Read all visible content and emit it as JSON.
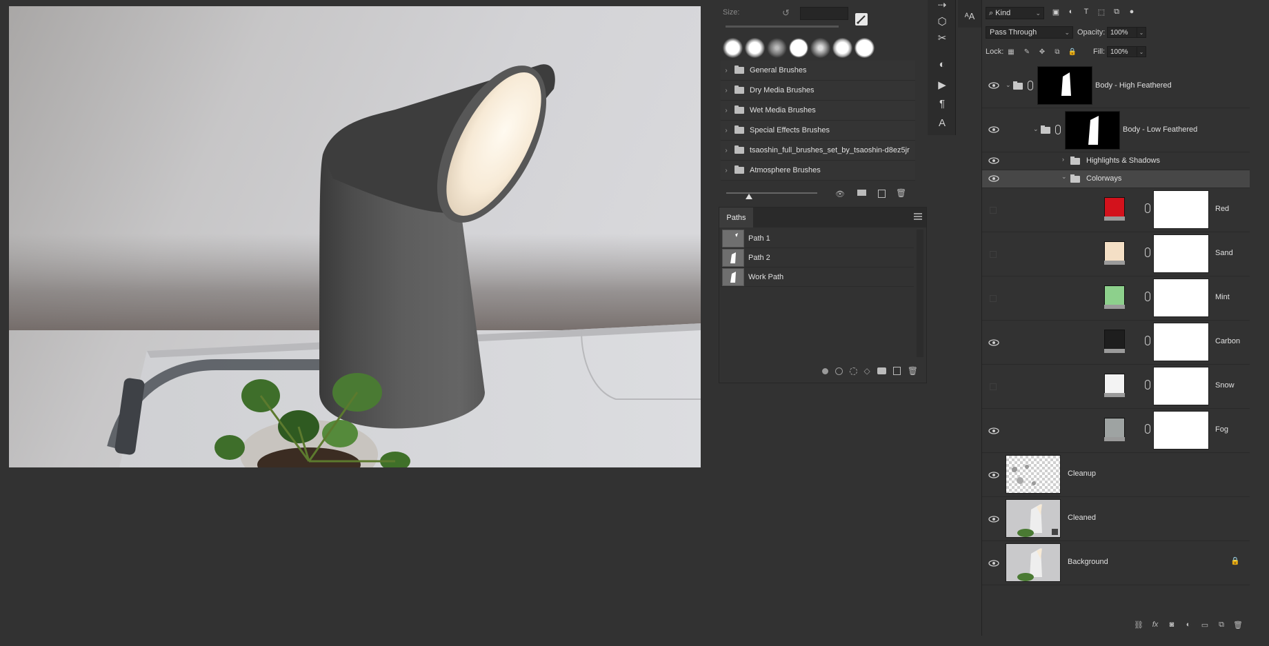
{
  "brushes": {
    "size_label": "Size:",
    "folders": [
      {
        "label": "General Brushes"
      },
      {
        "label": "Dry Media Brushes"
      },
      {
        "label": "Wet Media Brushes"
      },
      {
        "label": "Special Effects Brushes"
      },
      {
        "label": "tsaoshin_full_brushes_set_by_tsaoshin-d8ez5jr"
      },
      {
        "label": "Atmosphere Brushes"
      }
    ]
  },
  "paths": {
    "tab_label": "Paths",
    "items": [
      {
        "label": "Path 1"
      },
      {
        "label": "Path 2"
      },
      {
        "label": "Work Path"
      }
    ]
  },
  "tools": [
    "history-icon",
    "3d-icon",
    "tool-presets-icon",
    "adjustments-icon",
    "actions-icon",
    "paragraph-icon",
    "character-icon"
  ],
  "layers": {
    "filter_kind": "Kind",
    "blend_mode": "Pass Through",
    "opacity_label": "Opacity:",
    "opacity_value": "100%",
    "lock_label": "Lock:",
    "fill_label": "Fill:",
    "fill_value": "100%",
    "items": [
      {
        "name": "Body - High Feathered",
        "visible": true,
        "type": "group-mask"
      },
      {
        "name": "Body - Low Feathered",
        "visible": true,
        "type": "group-mask"
      },
      {
        "name": "Highlights & Shadows",
        "visible": true,
        "type": "group"
      },
      {
        "name": "Colorways",
        "visible": true,
        "type": "group",
        "selected": true
      },
      {
        "name": "Red",
        "visible": false,
        "type": "fill",
        "color": "#d3121c"
      },
      {
        "name": "Sand",
        "visible": false,
        "type": "fill",
        "color": "#f4dfc5"
      },
      {
        "name": "Mint",
        "visible": false,
        "type": "fill",
        "color": "#8dd08c"
      },
      {
        "name": "Carbon",
        "visible": true,
        "type": "fill",
        "color": "#1e1e1e"
      },
      {
        "name": "Snow",
        "visible": false,
        "type": "fill",
        "color": "#f3f3f3"
      },
      {
        "name": "Fog",
        "visible": true,
        "type": "fill",
        "color": "#9ea3a2"
      },
      {
        "name": "Cleanup",
        "visible": true,
        "type": "pixel"
      },
      {
        "name": "Cleaned",
        "visible": true,
        "type": "smart"
      },
      {
        "name": "Background",
        "visible": true,
        "type": "background",
        "locked": true
      }
    ]
  }
}
